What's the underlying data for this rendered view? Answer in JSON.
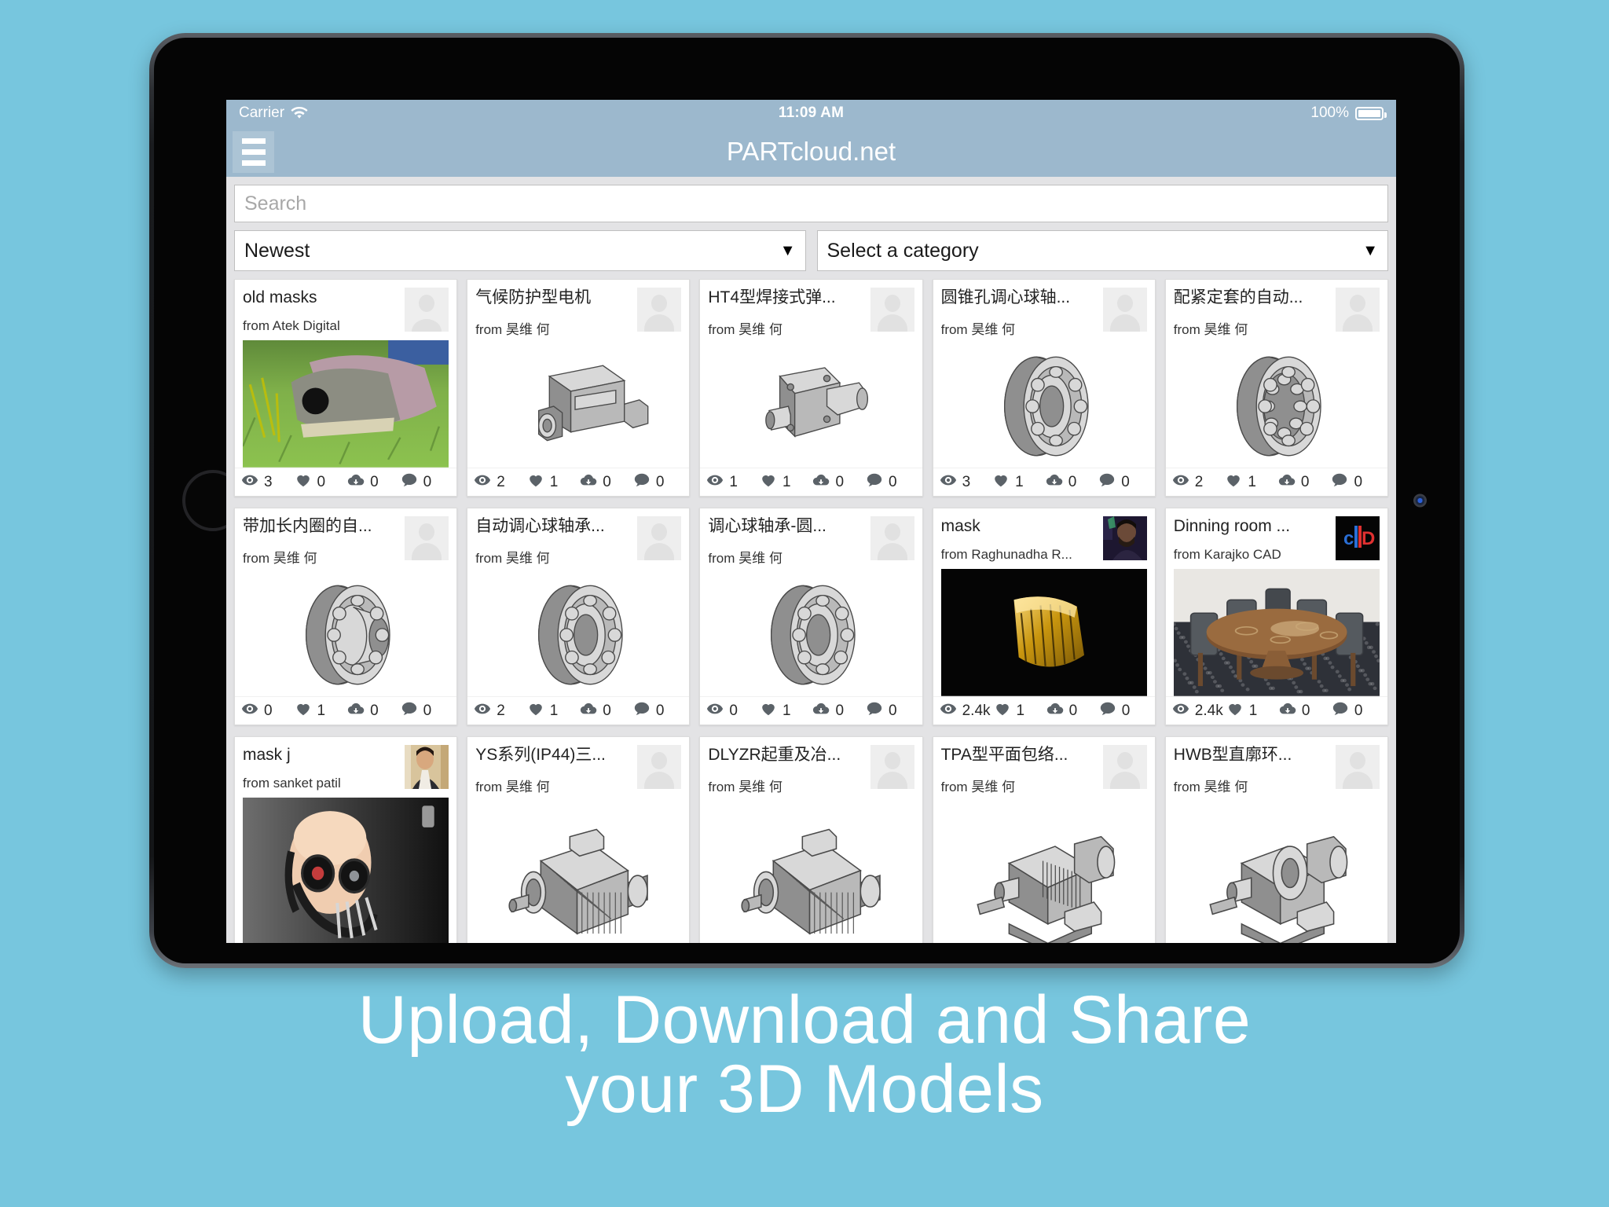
{
  "background_color": "#77c6de",
  "device": {
    "home_button": "home-button",
    "camera": "front-camera"
  },
  "status_bar": {
    "carrier": "Carrier",
    "wifi_icon": "wifi-icon",
    "time": "11:09 AM",
    "battery_percent": "100%",
    "battery_icon": "battery-full-icon",
    "bg_color": "#9cb8cd"
  },
  "nav_bar": {
    "menu_icon": "hamburger-menu-icon",
    "title": "PARTcloud.net"
  },
  "search": {
    "placeholder": "Search",
    "value": ""
  },
  "filters": {
    "sort": {
      "value": "Newest",
      "caret": "▼"
    },
    "category": {
      "value": "Select a category",
      "caret": "▼"
    }
  },
  "stat_icons": {
    "views": "eye-icon",
    "likes": "heart-icon",
    "downloads": "cloud-download-icon",
    "comments": "comment-bubble-icon"
  },
  "cards": [
    {
      "title": "old masks",
      "author": "from Atek Digital",
      "views": "3",
      "likes": "0",
      "downloads": "0",
      "comments": "0",
      "avatar": "photo-skull",
      "thumb": "photo-skull-grass"
    },
    {
      "title": "气候防护型电机",
      "author": "from 昊维 何",
      "views": "2",
      "likes": "1",
      "downloads": "0",
      "comments": "0",
      "avatar": "placeholder",
      "thumb": "cad-motor-box"
    },
    {
      "title": "HT4型焊接式弹...",
      "author": "from 昊维 何",
      "views": "1",
      "likes": "1",
      "downloads": "0",
      "comments": "0",
      "avatar": "placeholder",
      "thumb": "cad-flange-shaft"
    },
    {
      "title": "圆锥孔调心球轴...",
      "author": "from 昊维 何",
      "views": "3",
      "likes": "1",
      "downloads": "0",
      "comments": "0",
      "avatar": "placeholder",
      "thumb": "cad-bearing"
    },
    {
      "title": "配紧定套的自动...",
      "author": "from 昊维 何",
      "views": "2",
      "likes": "1",
      "downloads": "0",
      "comments": "0",
      "avatar": "placeholder",
      "thumb": "cad-bearing-sleeve"
    },
    {
      "title": "带加长内圈的自...",
      "author": "from 昊维 何",
      "views": "0",
      "likes": "1",
      "downloads": "0",
      "comments": "0",
      "avatar": "placeholder",
      "thumb": "cad-bearing-ext"
    },
    {
      "title": "自动调心球轴承...",
      "author": "from 昊维 何",
      "views": "2",
      "likes": "1",
      "downloads": "0",
      "comments": "0",
      "avatar": "placeholder",
      "thumb": "cad-bearing"
    },
    {
      "title": "调心球轴承-圆...",
      "author": "from 昊维 何",
      "views": "0",
      "likes": "1",
      "downloads": "0",
      "comments": "0",
      "avatar": "placeholder",
      "thumb": "cad-bearing"
    },
    {
      "title": "mask",
      "author": "from Raghunadha R...",
      "views": "2.4k",
      "likes": "1",
      "downloads": "0",
      "comments": "0",
      "avatar": "photo-person-dark",
      "thumb": "photo-gold-mask"
    },
    {
      "title": "Dinning room ...",
      "author": "from Karajko CAD",
      "views": "2.4k",
      "likes": "1",
      "downloads": "0",
      "comments": "0",
      "avatar": "logo-cad",
      "thumb": "photo-dining-table"
    },
    {
      "title": "mask j",
      "author": "from sanket patil",
      "views": "",
      "likes": "",
      "downloads": "",
      "comments": "",
      "avatar": "photo-person-light",
      "thumb": "photo-gas-mask"
    },
    {
      "title": "YS系列(IP44)三...",
      "author": "from 昊维 何",
      "views": "",
      "likes": "",
      "downloads": "",
      "comments": "",
      "avatar": "placeholder",
      "thumb": "cad-electric-motor"
    },
    {
      "title": "DLYZR起重及冶...",
      "author": "from 昊维 何",
      "views": "",
      "likes": "",
      "downloads": "",
      "comments": "",
      "avatar": "placeholder",
      "thumb": "cad-electric-motor"
    },
    {
      "title": "TPA型平面包络...",
      "author": "from 昊维 何",
      "views": "",
      "likes": "",
      "downloads": "",
      "comments": "",
      "avatar": "placeholder",
      "thumb": "cad-gearbox"
    },
    {
      "title": "HWB型直廓环...",
      "author": "from 昊维 何",
      "views": "",
      "likes": "",
      "downloads": "",
      "comments": "",
      "avatar": "placeholder",
      "thumb": "cad-gearbox-2"
    }
  ],
  "caption": {
    "line1": "Upload, Download and Share",
    "line2": "your 3D Models"
  }
}
